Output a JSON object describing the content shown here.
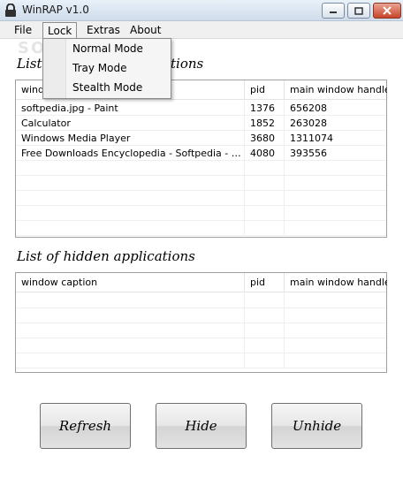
{
  "window": {
    "title": "WinRAP v1.0"
  },
  "menubar": {
    "items": [
      "File",
      "Lock",
      "Extras",
      "About"
    ]
  },
  "lock_menu": {
    "items": [
      "Normal Mode",
      "Tray Mode",
      "Stealth Mode"
    ]
  },
  "visible_list": {
    "title_visible_fragments": [
      "List",
      "tions"
    ],
    "columns": [
      "windo",
      "pid",
      "main window handle"
    ],
    "rows": [
      [
        "softpedia.jpg - Paint",
        "1376",
        "656208"
      ],
      [
        "Calculator",
        "1852",
        "263028"
      ],
      [
        "Windows Media Player",
        "3680",
        "1311074"
      ],
      [
        "Free Downloads Encyclopedia - Softpedia - Windo...",
        "4080",
        "393556"
      ]
    ]
  },
  "hidden_list": {
    "title": "List of hidden applications",
    "columns": [
      "window caption",
      "pid",
      "main window handle"
    ],
    "rows": []
  },
  "buttons": {
    "refresh": "Refresh",
    "hide": "Hide",
    "unhide": "Unhide"
  },
  "watermark": "SOFTPEDIA",
  "colors": {
    "close_button": "#c8452a",
    "titlebar": "#dbe5f0",
    "menubar": "#f0f0f0"
  }
}
